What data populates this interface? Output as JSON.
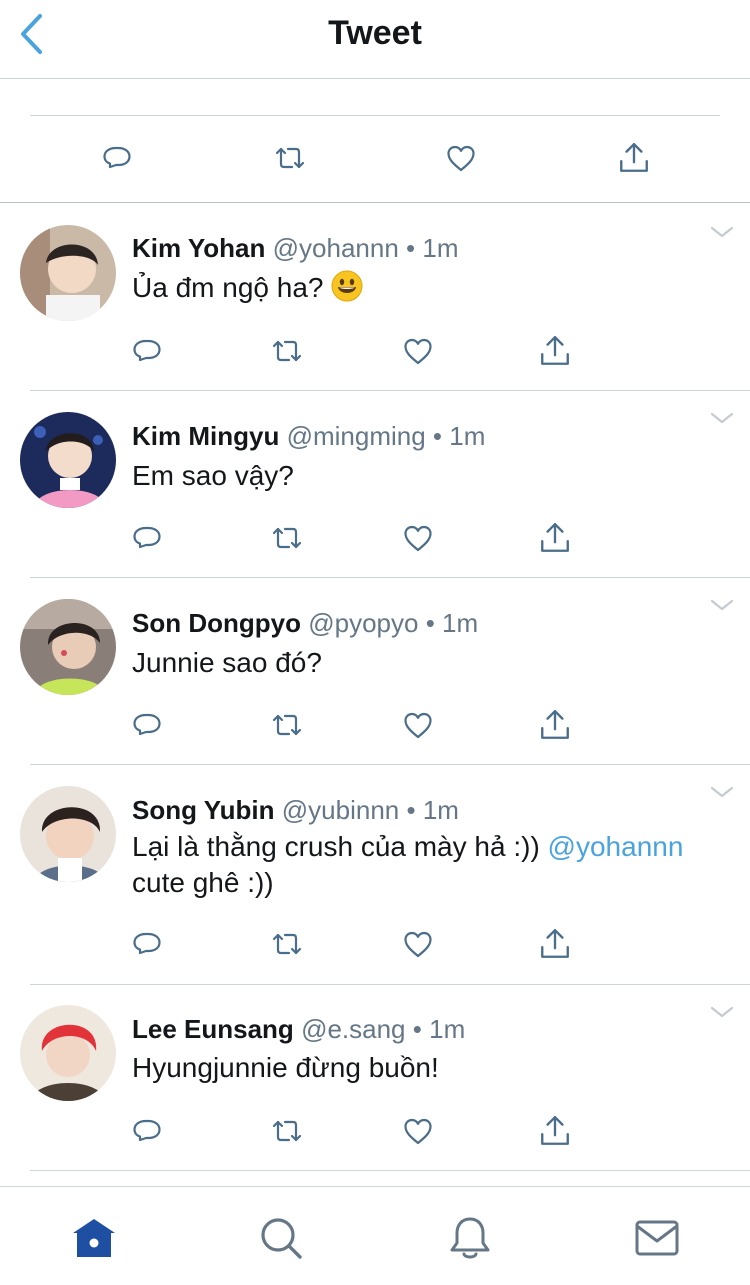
{
  "header": {
    "title": "Tweet"
  },
  "colors": {
    "accent": "#1da1f2",
    "mention": "#4aa3df",
    "tab_active": "#1f4fa3",
    "icon": "#657786"
  },
  "replies": [
    {
      "name": "Kim Yohan",
      "handle": "@yohannn",
      "dot": "•",
      "time": "1m",
      "text": "Ủa đm ngộ ha? ",
      "emoji": "grinning-face"
    },
    {
      "name": "Kim Mingyu",
      "handle": "@mingming",
      "dot": "•",
      "time": "1m",
      "text": "Em sao vậy?"
    },
    {
      "name": "Son Dongpyo",
      "handle": "@pyopyo",
      "dot": "•",
      "time": "1m",
      "text": "Junnie sao đó?"
    },
    {
      "name": "Song Yubin",
      "handle": "@yubinnn",
      "dot": "•",
      "time": "1m",
      "text_before": "Lại là thằng crush của mày hả :)) ",
      "mention": "@yohannn",
      "text_after": "cute ghê :))"
    },
    {
      "name": "Lee Eunsang",
      "handle": "@e.sang",
      "dot": "•",
      "time": "1m",
      "text": "Hyungjunnie đừng buồn!"
    }
  ],
  "tabbar": {
    "items": [
      "home-icon",
      "search-icon",
      "bell-icon",
      "mail-icon"
    ],
    "active": "home"
  }
}
